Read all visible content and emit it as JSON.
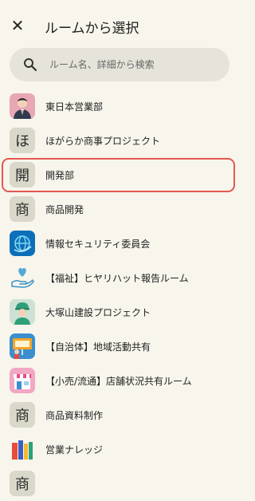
{
  "header": {
    "close_glyph": "✕",
    "title": "ルームから選択"
  },
  "search": {
    "placeholder": "ルーム名、詳細から検索",
    "value": ""
  },
  "rooms": [
    {
      "label": "東日本営業部",
      "avatar": "person-photo"
    },
    {
      "label": "ほがらか商事プロジェクト",
      "avatar_text": "ほ"
    },
    {
      "label": "開発部",
      "avatar_text": "開",
      "selected": true
    },
    {
      "label": "商品開発",
      "avatar_text": "商"
    },
    {
      "label": "情報セキュリティ委員会",
      "avatar": "globe-icon"
    },
    {
      "label": "【福祉】ヒヤリハット報告ルーム",
      "avatar": "heart-hand-icon"
    },
    {
      "label": "大塚山建設プロジェクト",
      "avatar": "worker-icon"
    },
    {
      "label": "【自治体】地域活動共有",
      "avatar": "presentation-icon"
    },
    {
      "label": "【小売/流通】店舗状況共有ルーム",
      "avatar": "store-icon"
    },
    {
      "label": "商品資料制作",
      "avatar_text": "商"
    },
    {
      "label": "営業ナレッジ",
      "avatar": "books-icon"
    },
    {
      "label": "",
      "avatar_text": "商"
    }
  ],
  "colors": {
    "background": "#f7f5ec",
    "search_bg": "#e6e4da",
    "highlight": "#e4584f",
    "avatar_bg": "#d9d8ca"
  }
}
